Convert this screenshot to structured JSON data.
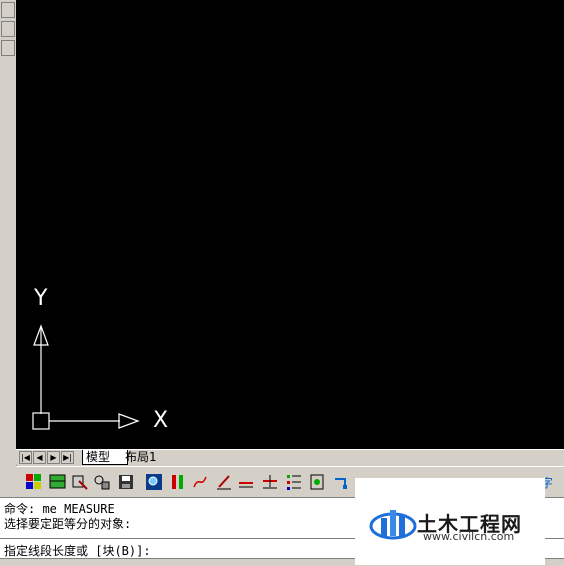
{
  "tabs": {
    "model": "模型",
    "layout1": "布局1"
  },
  "command": {
    "line1": "命令: me MEASURE",
    "line2": "选择要定距等分的对象:",
    "prompt": "指定线段长度或 [块(B)]:"
  },
  "ucs": {
    "x_label": "X",
    "y_label": "Y"
  },
  "watermark": {
    "brand": "土木工程网",
    "url": "www.civilcn.com"
  },
  "toolbar_partial_char": "字",
  "colors": {
    "canvas": "#000000",
    "ui_gray": "#d4d0c8",
    "accent_blue": "#1e6fd9"
  }
}
